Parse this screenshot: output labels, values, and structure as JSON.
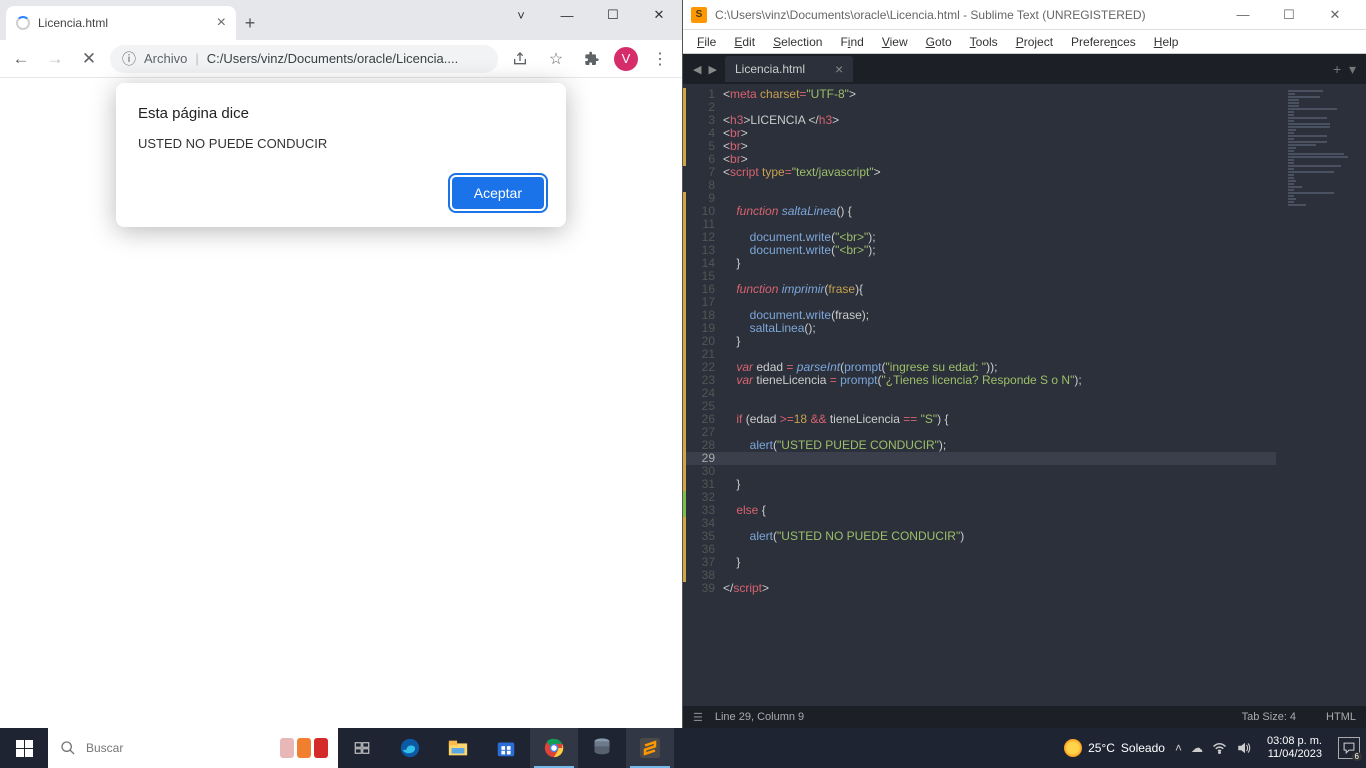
{
  "chrome": {
    "tab_title": "Licencia.html",
    "address_label": "Archivo",
    "address_path": "C:/Users/vinz/Documents/oracle/Licencia....",
    "avatar_letter": "V",
    "dialog": {
      "title": "Esta página dice",
      "message": "USTED NO PUEDE CONDUCIR",
      "accept": "Aceptar"
    }
  },
  "sublime": {
    "title": "C:\\Users\\vinz\\Documents\\oracle\\Licencia.html - Sublime Text (UNREGISTERED)",
    "menu": [
      "File",
      "Edit",
      "Selection",
      "Find",
      "View",
      "Goto",
      "Tools",
      "Project",
      "Preferences",
      "Help"
    ],
    "tab_name": "Licencia.html",
    "status_left": "Line 29, Column 9",
    "status_tabsize": "Tab Size: 4",
    "status_lang": "HTML",
    "lines": 39
  },
  "taskbar": {
    "search_placeholder": "Buscar",
    "weather_temp": "25°C",
    "weather_desc": "Soleado",
    "time": "03:08 p. m.",
    "date": "11/04/2023",
    "notif_count": "6"
  }
}
